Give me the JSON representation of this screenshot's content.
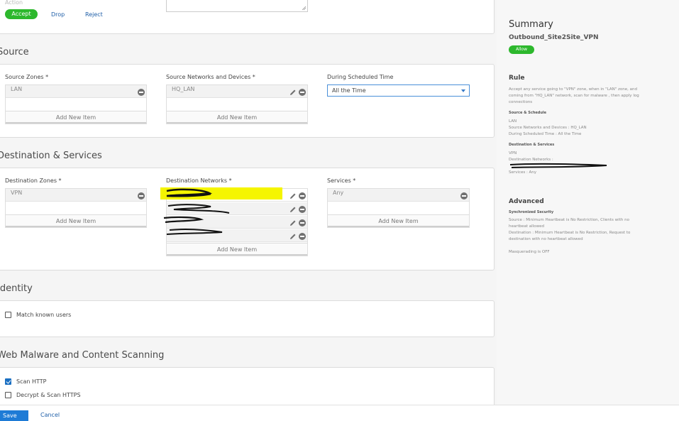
{
  "action": {
    "label": "Action",
    "accept": "Accept",
    "drop": "Drop",
    "reject": "Reject"
  },
  "source": {
    "title": "Source",
    "zones_label": "Source Zones *",
    "zones_value": "LAN",
    "networks_label": "Source Networks and Devices *",
    "networks_value": "HQ_LAN",
    "schedule_label": "During Scheduled Time",
    "schedule_value": "All the Time",
    "add_new": "Add New Item"
  },
  "destination": {
    "title": "Destination & Services",
    "zones_label": "Destination Zones *",
    "zones_value": "VPN",
    "networks_label": "Destination Networks *",
    "services_label": "Services *",
    "services_value": "Any",
    "add_new": "Add New Item"
  },
  "identity": {
    "title": "Identity",
    "match_known_users": "Match known users"
  },
  "web": {
    "title": "Web Malware and Content Scanning",
    "scan_http": "Scan HTTP",
    "decrypt_https": "Decrypt & Scan HTTPS"
  },
  "footer": {
    "save": "Save",
    "cancel": "Cancel"
  },
  "summary": {
    "title": "Summary",
    "rule_name": "Outbound_Site2Site_VPN",
    "badge": "Allow",
    "rule_heading": "Rule",
    "rule_desc": "Accept any service going to \"VPN\" zone, when in \"LAN\" zone, and coming from \"HQ_LAN\" network, scan for malware , then apply log connections",
    "src_sched_heading": "Source & Schedule",
    "src_lines": [
      "LAN",
      "Source Networks and Devices : HQ_LAN",
      "During Scheduled Time : All the Time"
    ],
    "dst_heading": "Destination & Services",
    "dst_lines": [
      "VPN",
      "Destination Networks :"
    ],
    "services_line": "Services : Any",
    "advanced_heading": "Advanced",
    "sync_heading": "Synchronized Security",
    "sync_source": "Source : Minimum Heartbeat is No Restriction, Clients with no heartbeat allowed",
    "sync_dest": "Destination : Minimum Heartbeat is No Restriction, Request to destination with no heartbeat allowed",
    "masquerading": "Masquerading is OFF"
  },
  "colors": {
    "accent_blue": "#1e7bd6",
    "accept_green": "#2db82d",
    "highlight_yellow": "#f5f500"
  }
}
